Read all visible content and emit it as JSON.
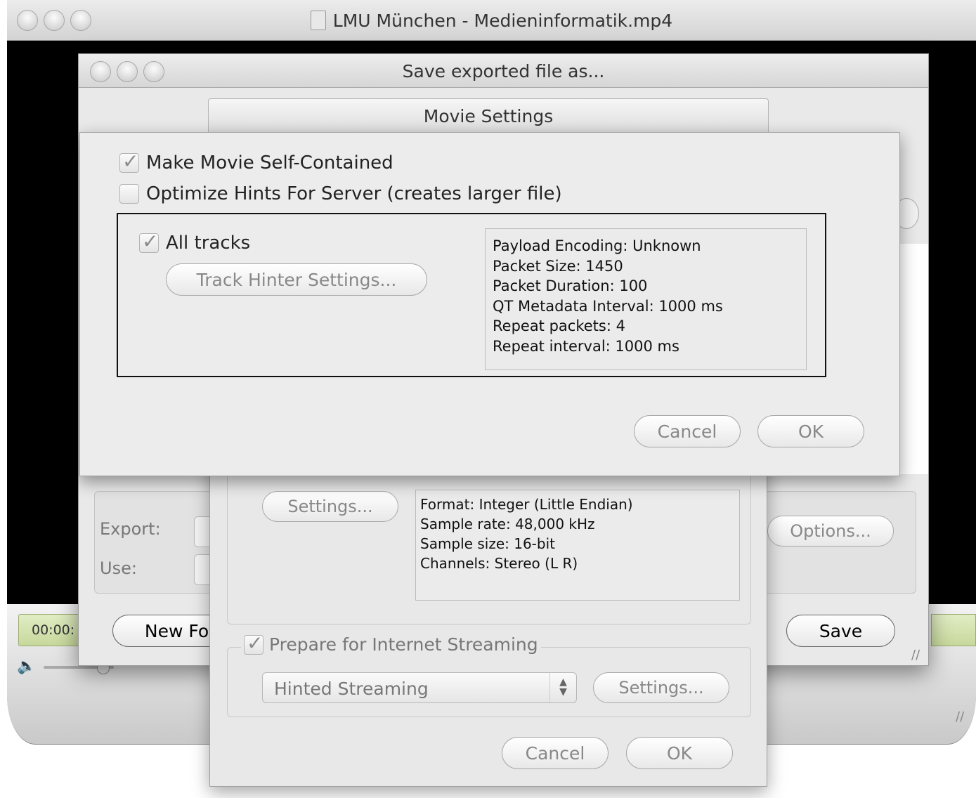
{
  "main_window": {
    "title": "LMU München - Medieninformatik.mp4",
    "timecode": "00:00:"
  },
  "save_dialog": {
    "title": "Save exported file as...",
    "export_label": "Export:",
    "use_label": "Use:",
    "options_label": "Options...",
    "new_folder_label": "New Fol",
    "save_label": "Save"
  },
  "sound_panel": {
    "settings_label": "Settings...",
    "info_lines": [
      "Format: Integer (Little Endian)",
      "Sample rate: 48,000 kHz",
      "Sample size: 16-bit",
      "Channels: Stereo (L R)"
    ],
    "streaming_label": "Prepare for Internet Streaming",
    "streaming_checked": true,
    "streaming_type": "Hinted Streaming",
    "streaming_settings_label": "Settings...",
    "cancel_label": "Cancel",
    "ok_label": "OK"
  },
  "movie_settings": {
    "title": "Movie Settings",
    "self_contained_label": "Make Movie Self-Contained",
    "self_contained_checked": true,
    "optimize_label": "Optimize Hints For Server (creates larger file)",
    "optimize_checked": false,
    "all_tracks_label": "All tracks",
    "all_tracks_checked": true,
    "track_hinter_label": "Track Hinter Settings...",
    "hint_info_lines": [
      "Payload Encoding: Unknown",
      "Packet Size: 1450",
      "Packet Duration: 100",
      "QT Metadata Interval: 1000 ms",
      "Repeat packets: 4",
      "Repeat interval: 1000 ms"
    ],
    "cancel_label": "Cancel",
    "ok_label": "OK"
  },
  "icons": {
    "volume": "speaker-icon",
    "window_controls": "traffic-light-icon",
    "resize": "resize-grip-icon",
    "popup_arrows": "up-down-arrows-icon"
  }
}
